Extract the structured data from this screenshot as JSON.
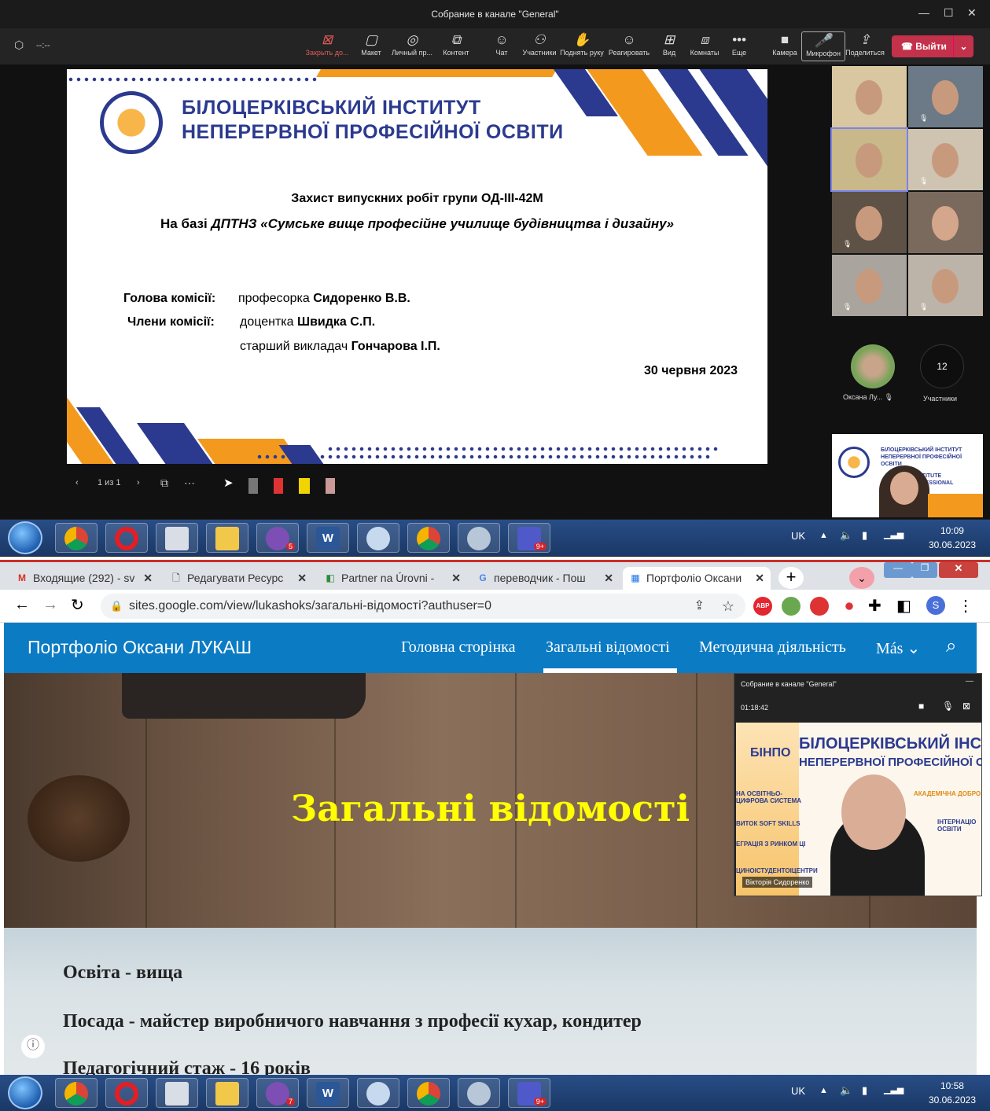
{
  "top_window": {
    "title": "Собрание в канале \"General\"",
    "timer": "--:--",
    "toolbar": [
      {
        "icon": "close-box-icon",
        "label": "Закрыть до..."
      },
      {
        "icon": "layout-icon",
        "label": "Макет"
      },
      {
        "icon": "eye-icon",
        "label": "Личный пр..."
      },
      {
        "icon": "share-content-icon",
        "label": "Контент"
      },
      {
        "icon": "chat-icon",
        "label": "Чат"
      },
      {
        "icon": "people-icon",
        "label": "Участники"
      },
      {
        "icon": "hand-icon",
        "label": "Поднять руку"
      },
      {
        "icon": "smile-icon",
        "label": "Реагировать"
      },
      {
        "icon": "grid-icon",
        "label": "Вид"
      },
      {
        "icon": "rooms-icon",
        "label": "Комнаты"
      },
      {
        "icon": "more-icon",
        "label": "Еще"
      },
      {
        "icon": "camera-icon",
        "label": "Камера"
      },
      {
        "icon": "mic-icon",
        "label": "Микрофон"
      },
      {
        "icon": "share-icon",
        "label": "Поделиться"
      }
    ],
    "leave_label": "Выйти",
    "slide": {
      "institute_line1": "БІЛОЦЕРКІВСЬКИЙ ІНСТИТУТ",
      "institute_line2": "НЕПЕРЕРВНОЇ ПРОФЕСІЙНОЇ ОСВІТИ",
      "heading": "Захист випускних робіт групи ОД-ІІІ-42М",
      "subheading_prefix": "На базі ",
      "subheading_italic": "ДПТНЗ «Сумське вище професійне училище будівництва і дизайну»",
      "head_label": "Голова комісії:",
      "head_role": "професорка ",
      "head_name": "Сидоренко В.В.",
      "members_label": "Члени комісії:",
      "member1_role": "доцентка ",
      "member1_name": "Швидка С.П.",
      "member2_role": "старший викладач ",
      "member2_name": "Гончарова І.П.",
      "date": "30 червня 2023"
    },
    "slide_counter": "1 из 1",
    "pinned_name": "Оксана Лу...",
    "participants_count": "12",
    "participants_label": "Участники",
    "presenter_thumb": {
      "line1": "БІЛОЦЕРКІВСЬКИЙ ІНСТИТУТ",
      "line2": "НЕПЕРЕРВНОЇ ПРОФЕСІЙНОЇ ОСВІТИ",
      "line3": "RKVA INSTITUTE",
      "line4": "OUS PROFESSIONAL"
    }
  },
  "taskbar1": {
    "lang": "UK",
    "time": "10:09",
    "date": "30.06.2023",
    "badges": [
      "5",
      "9+"
    ]
  },
  "browser": {
    "tabs": [
      {
        "icon": "gmail-icon",
        "label": "Входящие (292) - sv"
      },
      {
        "icon": "doc-icon",
        "label": "Редагувати Ресурс"
      },
      {
        "icon": "partner-icon",
        "label": "Partner na Úrovni -"
      },
      {
        "icon": "google-icon",
        "label": "переводчик - Пош"
      },
      {
        "icon": "sites-icon",
        "label": "Портфоліо Оксани"
      }
    ],
    "url": "sites.google.com/view/lukashoks/загальні-відомості?authuser=0",
    "profile_letter": "S",
    "site_title": "Портфоліо Оксани ЛУКАШ",
    "nav": [
      "Головна сторінка",
      "Загальні відомості",
      "Методична діяльність",
      "Más"
    ],
    "hero_title": "Загальні відомості",
    "rows": [
      "Освіта    - вища",
      "Посада  - майстер виробничого навчання з професії кухар, кондитер",
      "Педагогічний стаж  - 16 років"
    ],
    "mini_meeting": {
      "title": "Собрание в канале \"General\"",
      "time": "01:18:42",
      "brand": "БІНПО",
      "line1": "БІЛОЦЕРКІВСЬКИЙ ІНСТИ",
      "line2": "НЕПЕРЕРВНОЇ ПРОФЕСІЙНОЇ ОС",
      "tags": [
        "НА ОСВІТНЬО-ЦИФРОВА СИСТЕМА",
        "ВИТОК SOFT SKILLS",
        "ЕГРАЦІЯ З РИНКОМ ЦІ",
        "ЦИНОІСТУДЕНТОІЦЕНТРИ",
        "АКАДЕМІЧНА ДОБРО",
        "ІНТЕРНАЦІО ОСВІТИ"
      ],
      "speaker": "Вікторія Сидоренко"
    }
  },
  "taskbar2": {
    "lang": "UK",
    "time": "10:58",
    "date": "30.06.2023",
    "badges": [
      "7",
      "9+"
    ]
  },
  "colors": {
    "teams_red": "#c4314b",
    "slide_blue": "#2b3a8f",
    "slide_orange": "#f39a1e",
    "site_blue": "#0b7bc4",
    "hero_yellow": "#ffff00"
  }
}
